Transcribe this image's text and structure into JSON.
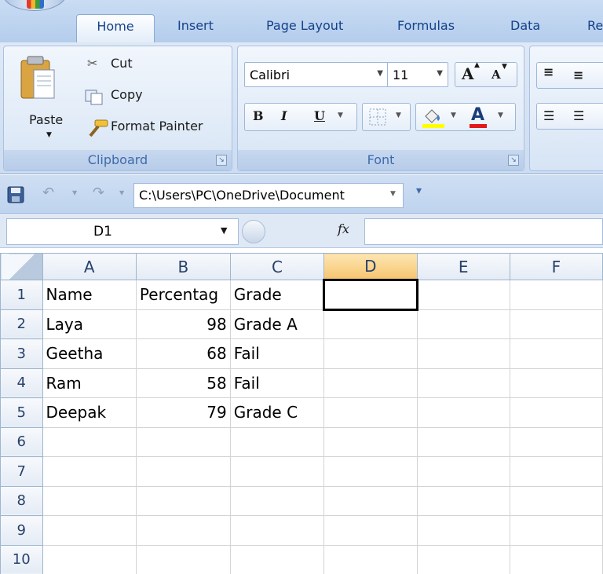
{
  "tabs": [
    {
      "label": "Home",
      "active": true
    },
    {
      "label": "Insert",
      "active": false
    },
    {
      "label": "Page Layout",
      "active": false
    },
    {
      "label": "Formulas",
      "active": false
    },
    {
      "label": "Data",
      "active": false
    },
    {
      "label": "Re",
      "active": false
    }
  ],
  "clipboard": {
    "paste_label": "Paste",
    "cut_label": "Cut",
    "copy_label": "Copy",
    "format_painter_label": "Format Painter",
    "group_label": "Clipboard"
  },
  "font": {
    "font_name": "Calibri",
    "font_size": "11",
    "bold_label": "B",
    "italic_label": "I",
    "underline_label": "U",
    "grow_label": "A",
    "shrink_label": "A",
    "font_color_label": "A",
    "group_label": "Font"
  },
  "qat": {
    "path": "C:\\Users\\PC\\OneDrive\\Document"
  },
  "formula_bar": {
    "name_box": "D1",
    "fx_label": "fx",
    "formula": ""
  },
  "grid": {
    "columns": [
      "A",
      "B",
      "C",
      "D",
      "E",
      "F"
    ],
    "active_column": "D",
    "rows": [
      {
        "num": "1",
        "cells": [
          "Name",
          "Percentag",
          "Grade",
          "",
          "",
          ""
        ]
      },
      {
        "num": "2",
        "cells": [
          "Laya",
          "98",
          "Grade A",
          "",
          "",
          ""
        ]
      },
      {
        "num": "3",
        "cells": [
          "Geetha",
          "68",
          "Fail",
          "",
          "",
          ""
        ]
      },
      {
        "num": "4",
        "cells": [
          "Ram",
          "58",
          "Fail",
          "",
          "",
          ""
        ]
      },
      {
        "num": "5",
        "cells": [
          "Deepak",
          "79",
          "Grade C",
          "",
          "",
          ""
        ]
      },
      {
        "num": "6",
        "cells": [
          "",
          "",
          "",
          "",
          "",
          ""
        ]
      },
      {
        "num": "7",
        "cells": [
          "",
          "",
          "",
          "",
          "",
          ""
        ]
      },
      {
        "num": "8",
        "cells": [
          "",
          "",
          "",
          "",
          "",
          ""
        ]
      },
      {
        "num": "9",
        "cells": [
          "",
          "",
          "",
          "",
          "",
          ""
        ]
      },
      {
        "num": "10",
        "cells": [
          "",
          "",
          "",
          "",
          "",
          ""
        ]
      }
    ]
  },
  "colors": {
    "ribbon_text": "#15428b",
    "selected_header": "#f7c56f",
    "font_color_bar": "#e0191b",
    "highlight_bar": "#ffff00"
  }
}
